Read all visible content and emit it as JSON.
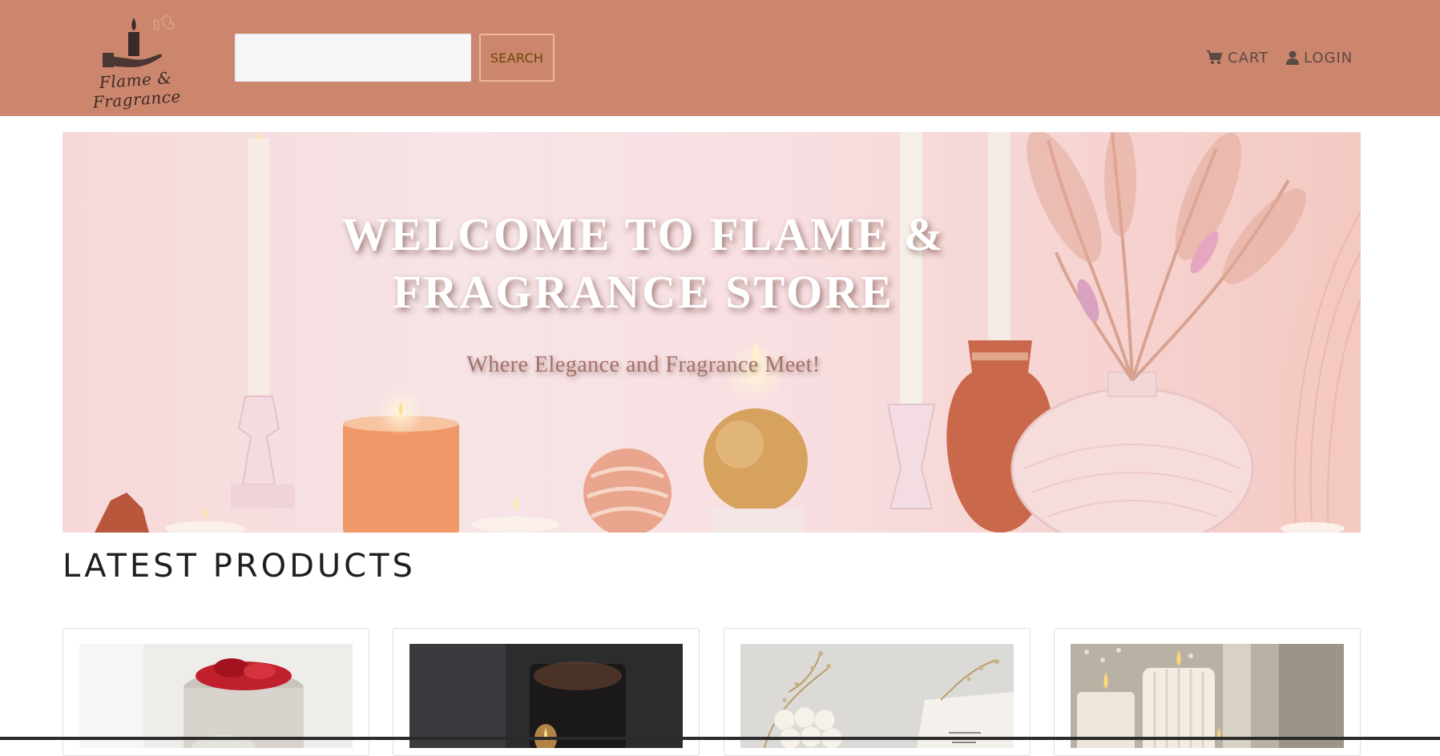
{
  "brand": {
    "logo_text": "Flame & Fragrance",
    "header_color": "#cc866d"
  },
  "search": {
    "value": "",
    "placeholder": "",
    "button_label": "SEARCH"
  },
  "nav": {
    "cart_label": "CART",
    "cart_icon": "shopping-cart-icon",
    "login_label": "LOGIN",
    "login_icon": "user-icon"
  },
  "hero": {
    "title_line1": "WELCOME TO FLAME &",
    "title_line2": "FRAGRANCE STORE",
    "subtitle": "Where Elegance and Fragrance Meet!"
  },
  "section": {
    "title": "LATEST PRODUCTS"
  },
  "products": [
    {
      "image": "rose-candle-image"
    },
    {
      "image": "dark-candle-image"
    },
    {
      "image": "bubble-candle-image"
    },
    {
      "image": "pillar-candles-image"
    }
  ]
}
